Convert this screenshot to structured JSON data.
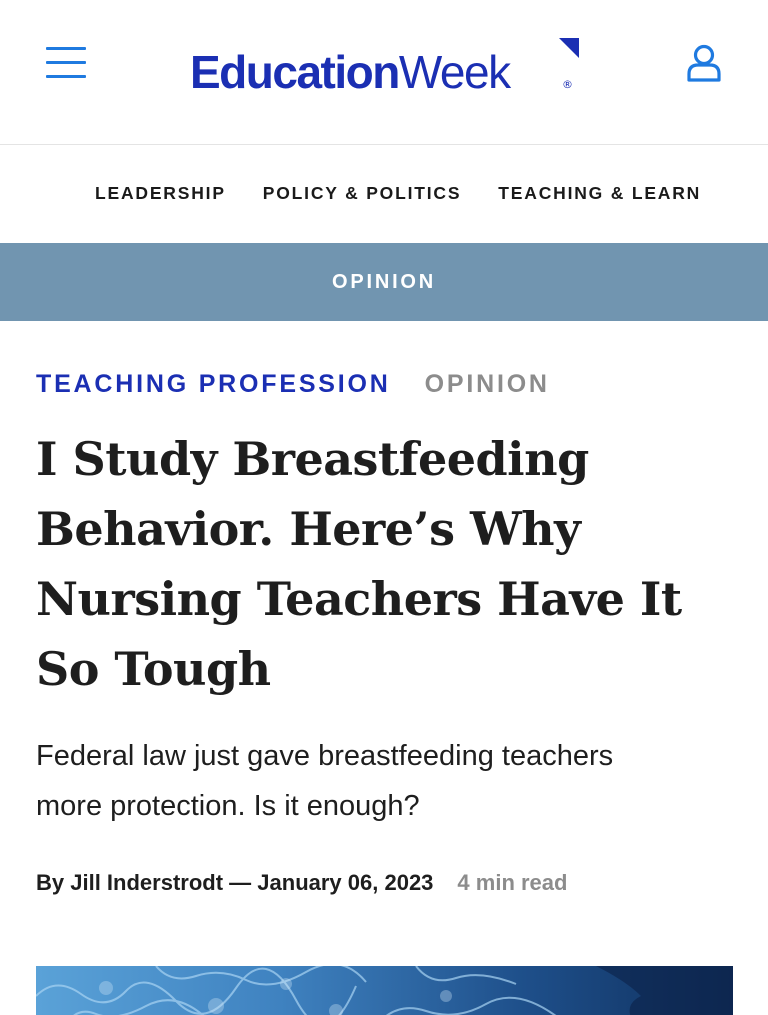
{
  "header": {
    "logo_bold": "Education",
    "logo_light": "Week",
    "logo_mark": "®",
    "menu_icon": "hamburger-menu-icon",
    "account_icon": "user-account-icon",
    "accent_color": "#1f7ae0",
    "brand_color": "#1b2fb3"
  },
  "section_nav": {
    "items": [
      {
        "label": "LEADERSHIP"
      },
      {
        "label": "POLICY & POLITICS"
      },
      {
        "label": "TEACHING & LEARN"
      }
    ]
  },
  "opinion_bar": {
    "label": "OPINION",
    "color": "#7195b0"
  },
  "article": {
    "tag_primary": "TEACHING PROFESSION",
    "tag_secondary": "OPINION",
    "headline_lines": [
      "I Study Breastfeeding",
      "Behavior. Here’s Why",
      "Nursing Teachers Have It",
      "So Tough"
    ],
    "dek_lines": [
      "Federal law just gave breastfeeding teachers",
      "more protection. Is it enough?"
    ],
    "byline_author": "By Jill Inderstrodt",
    "byline_separator": " — ",
    "byline_date": "January 06, 2023",
    "read_time": "4 min read"
  }
}
